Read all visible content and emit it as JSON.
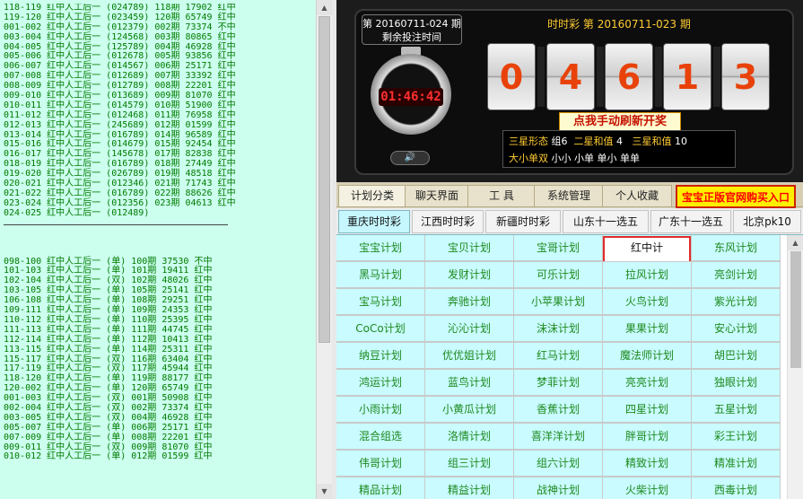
{
  "left_panel": {
    "lines_top": [
      "118-119 红中人工后一 (024789) 118期 17902 红中",
      "119-120 红中人工后一 (023459) 120期 65749 红中",
      "001-002 红中人工后一 (012379) 002期 73374 不中",
      "003-004 红中人工后一 (124568) 003期 80865 红中",
      "004-005 红中人工后一 (125789) 004期 46928 红中",
      "005-006 红中人工后一 (012678) 005期 93856 红中",
      "006-007 红中人工后一 (014567) 006期 25171 红中",
      "007-008 红中人工后一 (012689) 007期 33392 红中",
      "008-009 红中人工后一 (012789) 008期 22201 红中",
      "009-010 红中人工后一 (013689) 009期 81070 红中",
      "010-011 红中人工后一 (014579) 010期 51900 红中",
      "011-012 红中人工后一 (012468) 011期 76958 红中",
      "012-013 红中人工后一 (245689) 012期 01599 红中",
      "013-014 红中人工后一 (016789) 014期 96589 红中",
      "015-016 红中人工后一 (014679) 015期 92454 红中",
      "016-017 红中人工后一 (145678) 017期 82838 红中",
      "018-019 红中人工后一 (016789) 018期 27449 红中",
      "019-020 红中人工后一 (026789) 019期 48518 红中",
      "020-021 红中人工后一 (012346) 021期 71743 红中",
      "021-022 红中人工后一 (016789) 022期 88626 红中",
      "023-024 红中人工后一 (012356) 023期 04613 红中",
      "024-025 红中人工后一 (012489)"
    ],
    "lines_bottom": [
      "098-100 红中人工后一 (单) 100期 37530 不中",
      "101-103 红中人工后一 (单) 101期 19411 红中",
      "102-104 红中人工后一 (双) 102期 48026 红中",
      "103-105 红中人工后一 (单) 105期 25141 红中",
      "106-108 红中人工后一 (单) 108期 29251 红中",
      "109-111 红中人工后一 (单) 109期 24353 红中",
      "110-112 红中人工后一 (单) 110期 25395 红中",
      "111-113 红中人工后一 (单) 111期 44745 红中",
      "112-114 红中人工后一 (单) 112期 10413 红中",
      "113-115 红中人工后一 (单) 114期 25311 红中",
      "115-117 红中人工后一 (双) 116期 63404 红中",
      "117-119 红中人工后一 (双) 117期 45944 红中",
      "118-120 红中人工后一 (单) 119期 88177 红中",
      "120-002 红中人工后一 (单) 120期 65749 红中",
      "001-003 红中人工后一 (双) 001期 50908 红中",
      "002-004 红中人工后一 (双) 002期 73374 红中",
      "003-005 红中人工后一 (双) 004期 46928 红中",
      "005-007 红中人工后一 (单) 006期 25171 红中",
      "007-009 红中人工后一 (单) 008期 22201 红中",
      "009-011 红中人工后一 (双) 009期 81070 红中",
      "010-012 红中人工后一 (单) 012期 01599 红中"
    ]
  },
  "lottery": {
    "next_period": "第 20160711-024 期",
    "remaining_label": "剩余投注时间",
    "countdown": "01:46:42",
    "current_title": "时时彩    第 20160711-023 期",
    "digits": [
      "0",
      "4",
      "6",
      "1",
      "3"
    ],
    "refresh_label": "点我手动刷新开奖",
    "info": {
      "sanxing_label": "三星形态",
      "sanxing_value": "组6",
      "erxing_label": "二星和值",
      "erxing_value": "4",
      "sanxinghe_label": "三星和值",
      "sanxinghe_value": "10",
      "daxiao_label": "大小单双",
      "daxiao_value": "小小 小单 单小 单单"
    }
  },
  "tabs": [
    "计划分类",
    "聊天界面",
    "工  具",
    "系统管理",
    "个人收藏"
  ],
  "buy_label": "宝宝正版官网购买入口",
  "sub_tabs": [
    "重庆时时彩",
    "江西时时彩",
    "新疆时时彩",
    "山东十一选五",
    "广东十一选五",
    "北京pk10"
  ],
  "plans": [
    [
      "宝宝计划",
      "宝贝计划",
      "宝哥计划",
      "红中计划",
      "东风计划"
    ],
    [
      "黑马计划",
      "发财计划",
      "可乐计划",
      "拉风计划",
      "亮剑计划"
    ],
    [
      "宝马计划",
      "奔驰计划",
      "小苹果计划",
      "火鸟计划",
      "紫光计划"
    ],
    [
      "CoCo计划",
      "沁沁计划",
      "沫沫计划",
      "果果计划",
      "安心计划"
    ],
    [
      "纳豆计划",
      "优优姐计划",
      "红马计划",
      "魔法师计划",
      "胡巴计划"
    ],
    [
      "鸿运计划",
      "蓝鸟计划",
      "梦菲计划",
      "亮亮计划",
      "独眼计划"
    ],
    [
      "小雨计划",
      "小黄瓜计划",
      "香蕉计划",
      "四星计划",
      "五星计划"
    ],
    [
      "混合组选",
      "洛情计划",
      "喜洋洋计划",
      "胖哥计划",
      "彩王计划"
    ],
    [
      "伟哥计划",
      "组三计划",
      "组六计划",
      "精致计划",
      "精准计划"
    ],
    [
      "精品计划",
      "精益计划",
      "战神计划",
      "火柴计划",
      "西毒计划"
    ]
  ],
  "selected_plan": "红中计划"
}
